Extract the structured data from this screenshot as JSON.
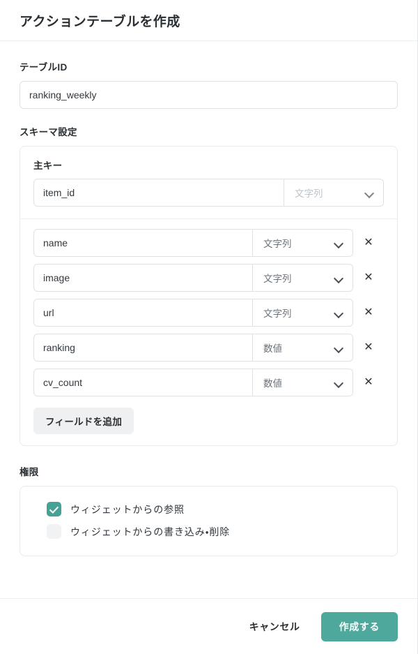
{
  "dialog": {
    "title": "アクションテーブルを作成"
  },
  "table_id": {
    "label": "テーブルID",
    "value": "ranking_weekly",
    "placeholder": ""
  },
  "schema": {
    "label": "スキーマ設定",
    "primary_key": {
      "label": "主キー",
      "name_value": "item_id",
      "name_placeholder": "",
      "type_value": "文字列",
      "disabled": true
    },
    "fields": [
      {
        "name": "name",
        "type": "文字列",
        "remove_label": "✕"
      },
      {
        "name": "image",
        "type": "文字列",
        "remove_label": "✕"
      },
      {
        "name": "url",
        "type": "文字列",
        "remove_label": "✕"
      },
      {
        "name": "ranking",
        "type": "数値",
        "remove_label": "✕"
      },
      {
        "name": "cv_count",
        "type": "数値",
        "remove_label": "✕"
      }
    ],
    "add_field_label": "フィールドを追加"
  },
  "permissions": {
    "label": "権限",
    "options": [
      {
        "label": "ウィジェットからの参照",
        "checked": true
      },
      {
        "label": "ウィジェットからの書き込み・削除",
        "checked": false
      }
    ]
  },
  "footer": {
    "cancel_label": "キャンセル",
    "submit_label": "作成する"
  },
  "colors": {
    "accent": "#4ea89c",
    "checkbox_checked": "#46a295",
    "text_primary": "#2b3034",
    "border": "#dfe2e5",
    "card_border": "#e8eaec",
    "muted_text": "#b7bcc2",
    "add_button_bg": "#eef0f1"
  }
}
